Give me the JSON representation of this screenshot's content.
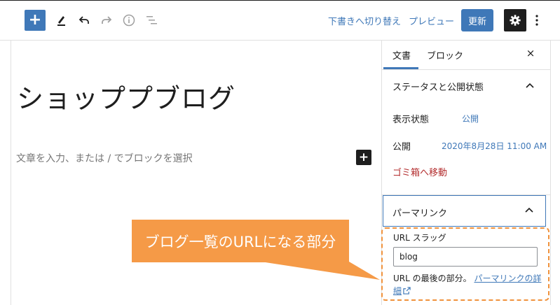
{
  "toolbar": {
    "add_block": "+",
    "save_draft_label": "下書きへ切り替え",
    "preview_label": "プレビュー",
    "update_label": "更新"
  },
  "editor": {
    "title": "ショッププブログ",
    "placeholder": "文章を入力、または / でブロックを選択",
    "inline_add": "+"
  },
  "sidebar": {
    "tabs": [
      {
        "label": "文書"
      },
      {
        "label": "ブロック"
      }
    ],
    "close_label": "×",
    "status_panel": {
      "title": "ステータスと公開状態",
      "visibility_label": "表示状態",
      "visibility_value": "公開",
      "publish_label": "公開",
      "publish_value": "2020年8月28日 11:00 AM",
      "trash_label": "ゴミ箱へ移動"
    },
    "permalink_panel": {
      "title": "パーマリンク",
      "slug_label": "URL スラッグ",
      "slug_value": "blog",
      "help_text": "URL の最後の部分。",
      "help_link": "パーマリンクの詳細"
    }
  },
  "callout": {
    "text": "ブログ一覧のURLになる部分",
    "color": "#f59a47"
  },
  "colors": {
    "accent": "#3f78b8",
    "danger": "#b32d2e",
    "highlight": "#f0923c"
  }
}
